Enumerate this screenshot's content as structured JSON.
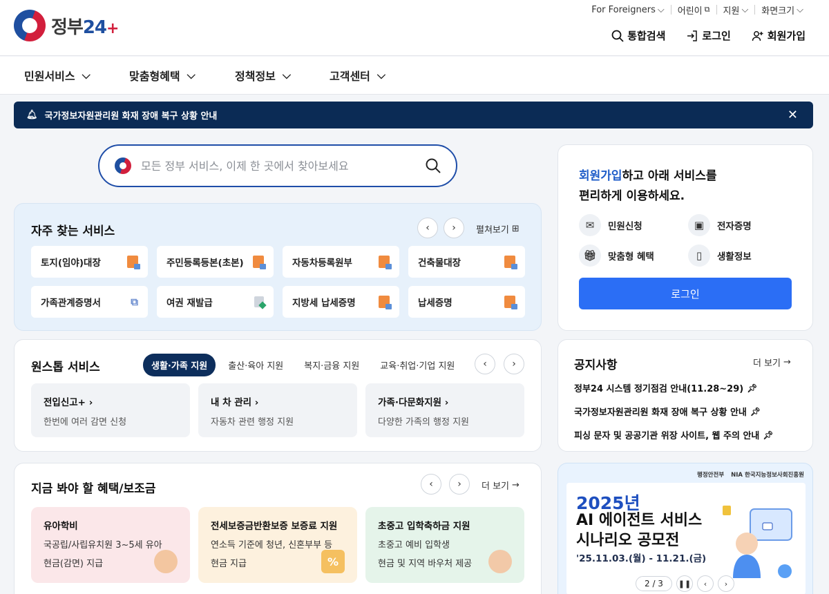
{
  "logo": {
    "brand": "정부",
    "num": "24",
    "plus": "+"
  },
  "utility": {
    "foreigners": "For Foreigners",
    "kids": "어린이",
    "support": "지원",
    "font_size": "화면크기"
  },
  "actions": {
    "search": "통합검색",
    "login": "로그인",
    "signup": "회원가입"
  },
  "nav": [
    "민원서비스",
    "맞춤형혜택",
    "정책정보",
    "고객센터"
  ],
  "alert": {
    "text": "국가정보자원관리원 화재 장애 복구 상황 안내"
  },
  "search": {
    "placeholder": "모든 정부 서비스, 이제 한 곳에서 찾아보세요"
  },
  "frequent": {
    "title": "자주 찾는 서비스",
    "more": "펼쳐보기",
    "items": [
      "토지(임야)대장",
      "주민등록등본(초본)",
      "자동차등록원부",
      "건축물대장",
      "가족관계증명서",
      "여권 재발급",
      "지방세 납세증명",
      "납세증명"
    ]
  },
  "onestop": {
    "title": "원스톱 서비스",
    "tabs": [
      "생활·가족 지원",
      "출산·육아 지원",
      "복지·금융 지원",
      "교육·취업·기업 지원"
    ],
    "boxes": [
      {
        "title": "전입신고+",
        "desc": "한번에 여러 감면 신청"
      },
      {
        "title": "내 차 관리",
        "desc": "자동차 관련 행정 지원"
      },
      {
        "title": "가족·다문화지원",
        "desc": "다양한 가족의 행정 지원"
      }
    ]
  },
  "benefits": {
    "title": "지금 봐야 할 혜택/보조금",
    "more": "더 보기",
    "items": [
      {
        "title": "유아학비",
        "line1": "국공립/사립유치원 3~5세 유아",
        "line2": "현금(감면) 지급"
      },
      {
        "title": "전세보증금반환보증 보증료 지원",
        "line1": "연소득 기준에 청년, 신혼부부 등",
        "line2": "현금 지급"
      },
      {
        "title": "초중고 입학축하금 지원",
        "line1": "초중고 예비 입학생",
        "line2": "현금 및 지역 바우처 제공"
      }
    ]
  },
  "side_login": {
    "highlight": "회원가입",
    "line1_rest": "하고 아래 서비스를",
    "line2": "편리하게 이용하세요.",
    "items": [
      "민원신청",
      "전자증명",
      "맞춤형 혜택",
      "생활정보"
    ],
    "button": "로그인"
  },
  "notice": {
    "title": "공지사항",
    "more": "더 보기",
    "items": [
      "정부24 시스템 정기점검 안내(11.28~29)",
      "국가정보자원관리원 화재 장애 복구 상황 안내",
      "피싱 문자 및 공공기관 위장 사이트, 웹 주의 안내"
    ]
  },
  "banner": {
    "org1": "행정안전부",
    "org2": "NIA 한국지능정보사회진흥원",
    "year": "2025년",
    "title1": "AI 에이전트 서비스",
    "title2": "시나리오 공모전",
    "date": "'25.11.03.(월) - 11.21.(금)",
    "page": "2 / 3"
  },
  "colors": {
    "navy": "#0b2b55",
    "primary": "#2b6ef5",
    "link": "#1e5cc8"
  }
}
